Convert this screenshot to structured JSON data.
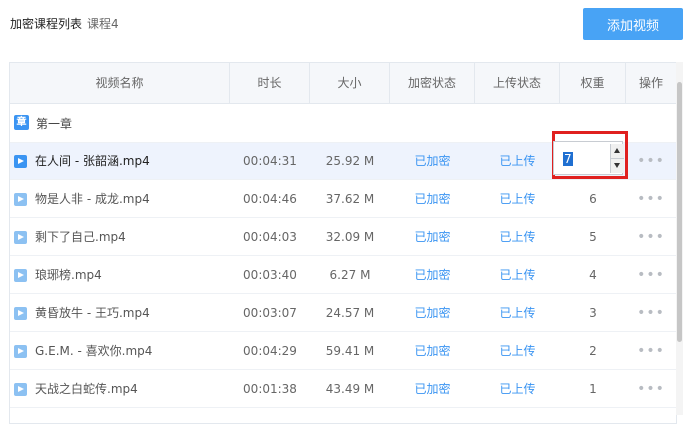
{
  "header": {
    "title": "加密课程列表",
    "course": "课程4",
    "add_button": "添加视频"
  },
  "columns": [
    "视频名称",
    "时长",
    "大小",
    "加密状态",
    "上传状态",
    "权重",
    "操作"
  ],
  "chapter": {
    "badge": "章",
    "label": "第一章"
  },
  "rows": [
    {
      "name": "在人间 - 张韶涵.mp4",
      "duration": "00:04:31",
      "size": "25.92 M",
      "encrypt": "已加密",
      "upload": "已上传",
      "weight": "7",
      "more": "•••"
    },
    {
      "name": "物是人非 - 成龙.mp4",
      "duration": "00:04:46",
      "size": "37.62 M",
      "encrypt": "已加密",
      "upload": "已上传",
      "weight": "6",
      "more": "•••"
    },
    {
      "name": "剩下了自己.mp4",
      "duration": "00:04:03",
      "size": "32.09 M",
      "encrypt": "已加密",
      "upload": "已上传",
      "weight": "5",
      "more": "•••"
    },
    {
      "name": "琅琊榜.mp4",
      "duration": "00:03:40",
      "size": "6.27 M",
      "encrypt": "已加密",
      "upload": "已上传",
      "weight": "4",
      "more": "•••"
    },
    {
      "name": "黄昏放牛 - 王巧.mp4",
      "duration": "00:03:07",
      "size": "24.57 M",
      "encrypt": "已加密",
      "upload": "已上传",
      "weight": "3",
      "more": "•••"
    },
    {
      "name": "G.E.M. - 喜欢你.mp4",
      "duration": "00:04:29",
      "size": "59.41 M",
      "encrypt": "已加密",
      "upload": "已上传",
      "weight": "2",
      "more": "•••"
    },
    {
      "name": "天战之白蛇传.mp4",
      "duration": "00:01:38",
      "size": "43.49 M",
      "encrypt": "已加密",
      "upload": "已上传",
      "weight": "1",
      "more": "•••"
    }
  ],
  "colors": {
    "accent": "#48a3f5",
    "status": "#3a94f2",
    "highlight_border": "#e0201f"
  }
}
